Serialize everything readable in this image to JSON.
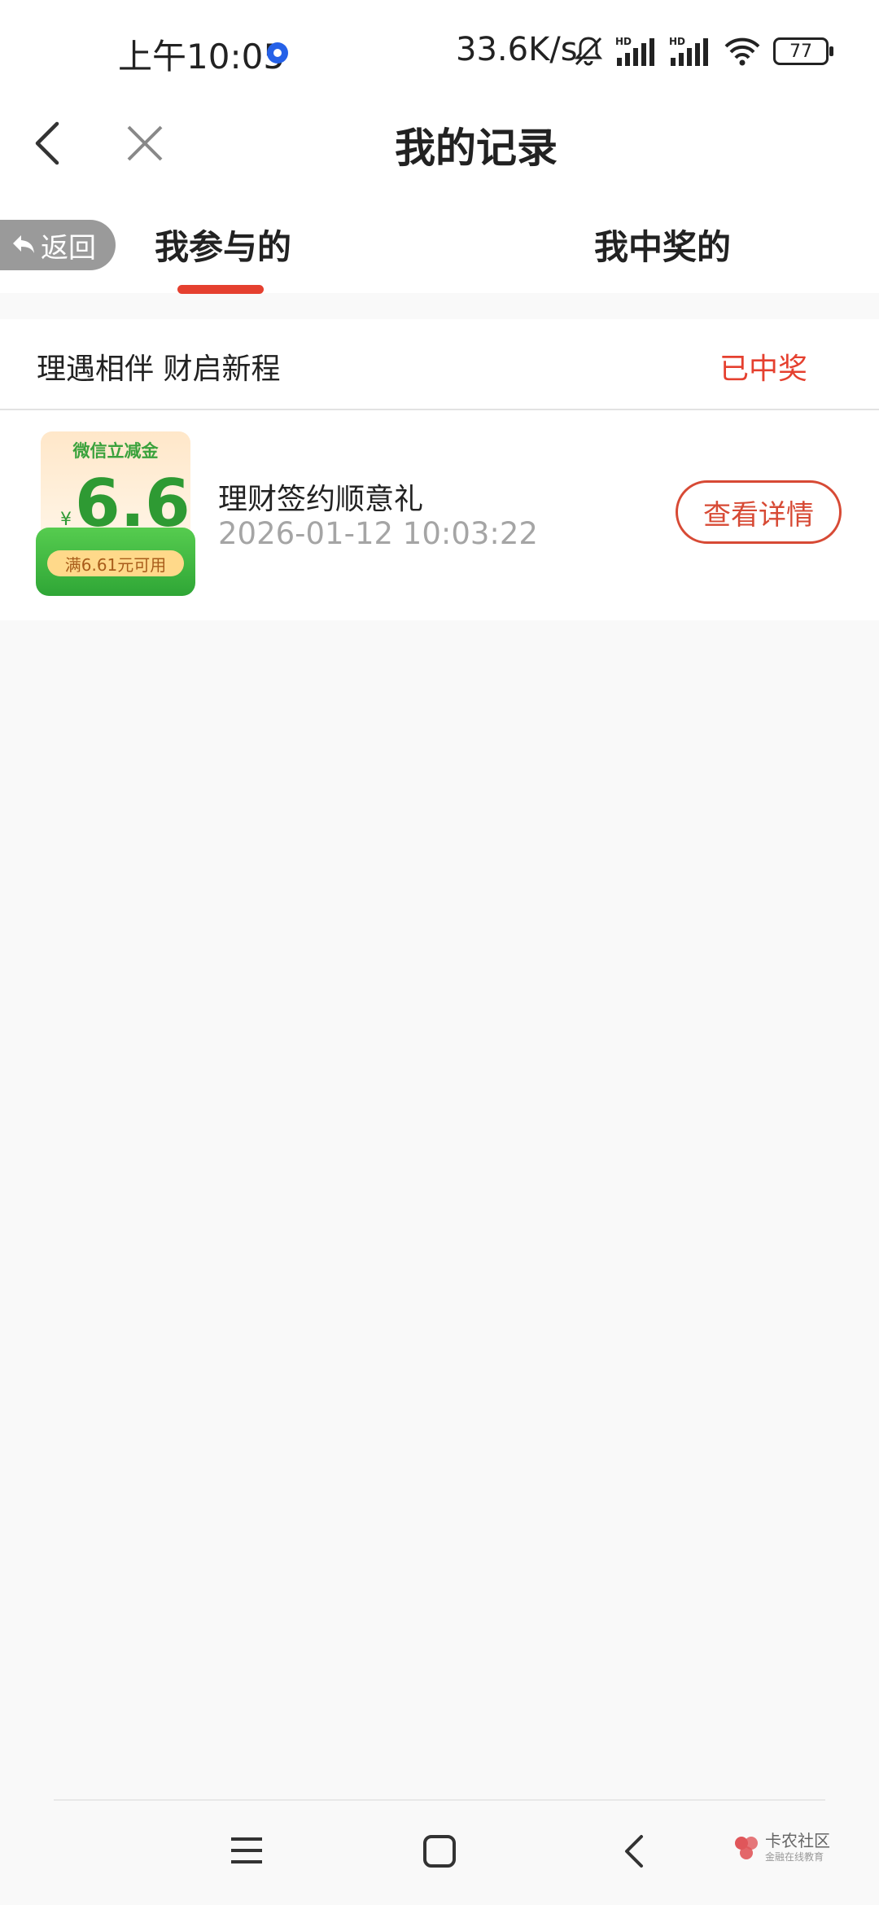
{
  "status_bar": {
    "time": "上午10:05",
    "network_speed": "33.6K/s",
    "battery": "77"
  },
  "header": {
    "title": "我的记录",
    "back_icon": "chevron-left-icon",
    "close_icon": "close-icon"
  },
  "return_button": {
    "label": "返回"
  },
  "tabs": [
    {
      "label": "我参与的",
      "active": true
    },
    {
      "label": "我中奖的",
      "active": false
    }
  ],
  "colors": {
    "accent": "#e5402f",
    "coupon_green": "#2fa636"
  },
  "records": [
    {
      "activity": "理遇相伴 财启新程",
      "status": "已中奖",
      "coupon": {
        "label": "微信立减金",
        "currency": "¥",
        "value": "6.6",
        "condition": "满6.61元可用"
      },
      "name": "理财签约顺意礼",
      "time": "2026-01-12 10:03:22",
      "button": "查看详情"
    }
  ],
  "watermark": {
    "title": "卡农社区",
    "subtitle": "金融在线教育"
  }
}
